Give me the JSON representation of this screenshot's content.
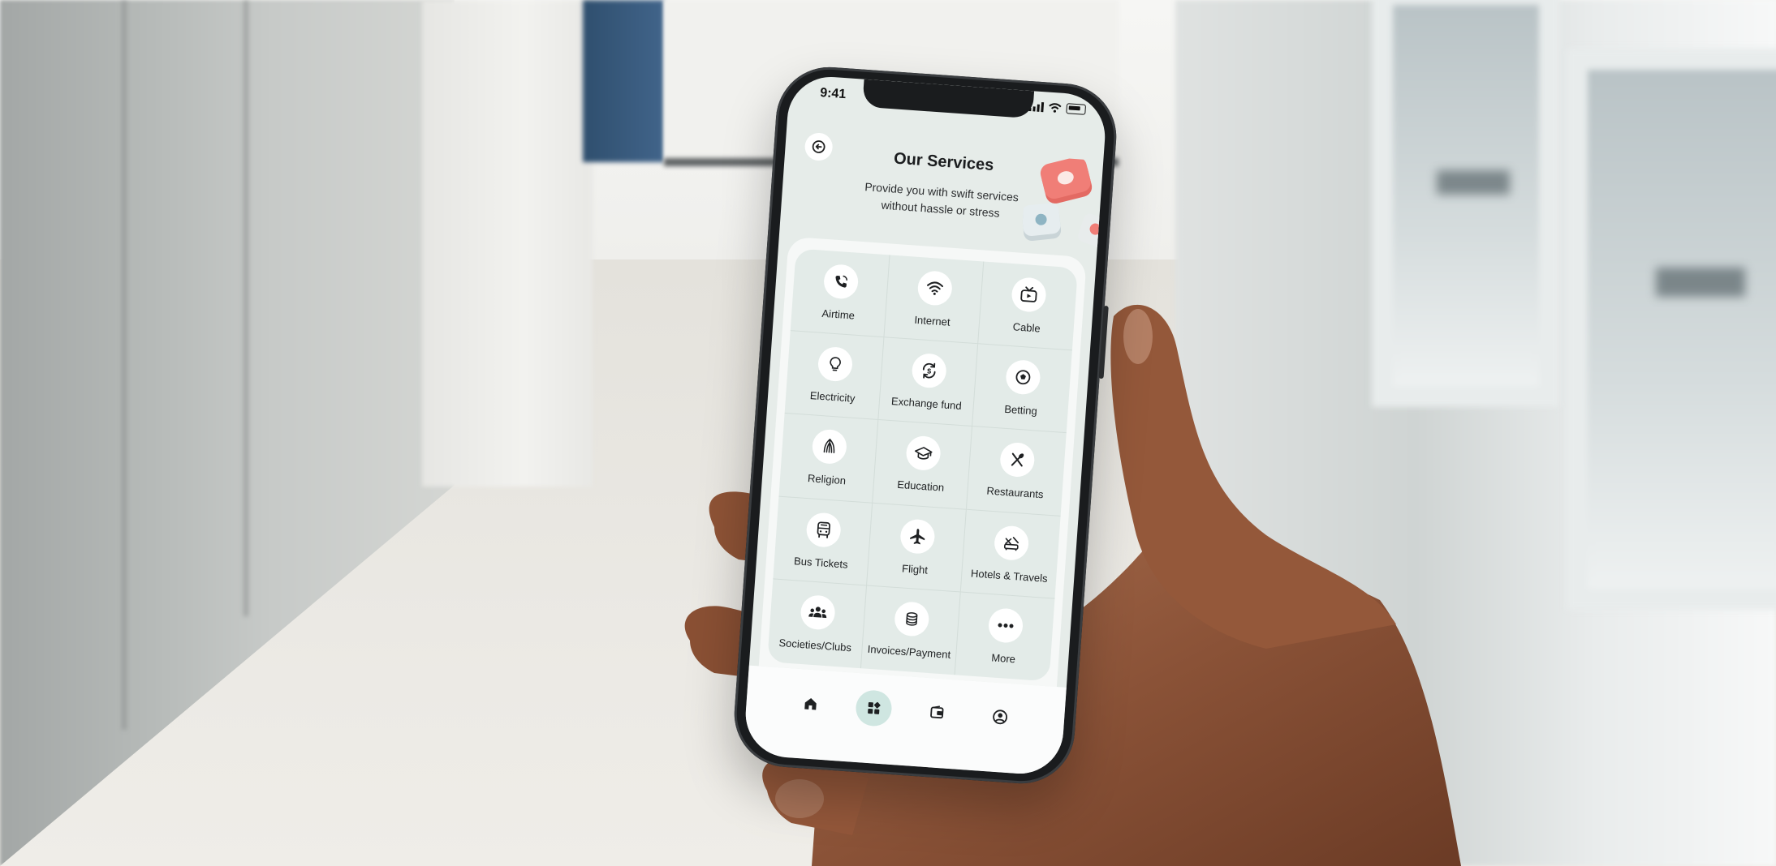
{
  "status_bar": {
    "time": "9:41"
  },
  "header": {
    "title": "Our Services",
    "subtitle_line1": "Provide you with swift services",
    "subtitle_line2": "without hassle or stress"
  },
  "services": [
    {
      "label": "Airtime",
      "icon": "phone-icon"
    },
    {
      "label": "Internet",
      "icon": "wifi-icon"
    },
    {
      "label": "Cable",
      "icon": "tv-icon"
    },
    {
      "label": "Electricity",
      "icon": "bulb-icon"
    },
    {
      "label": "Exchange fund",
      "icon": "exchange-icon"
    },
    {
      "label": "Betting",
      "icon": "ball-icon"
    },
    {
      "label": "Religion",
      "icon": "religion-icon"
    },
    {
      "label": "Education",
      "icon": "graduation-cap-icon"
    },
    {
      "label": "Restaurants",
      "icon": "cutlery-icon"
    },
    {
      "label": "Bus Tickets",
      "icon": "bus-icon"
    },
    {
      "label": "Flight",
      "icon": "plane-icon"
    },
    {
      "label": "Hotels & Travels",
      "icon": "hotel-icon"
    },
    {
      "label": "Societies/Clubs",
      "icon": "people-icon"
    },
    {
      "label": "Invoices/Payment",
      "icon": "coins-icon"
    },
    {
      "label": "More",
      "icon": "more-icon"
    }
  ],
  "tabbar": {
    "tabs": [
      "home-icon",
      "services-grid-icon",
      "wallet-icon",
      "profile-icon"
    ],
    "active": "services-grid-icon"
  },
  "colors": {
    "accent_active_tab": "#cfe6e1",
    "grid_background": "#e3ebe8",
    "screen_background": "#e6ece9"
  }
}
